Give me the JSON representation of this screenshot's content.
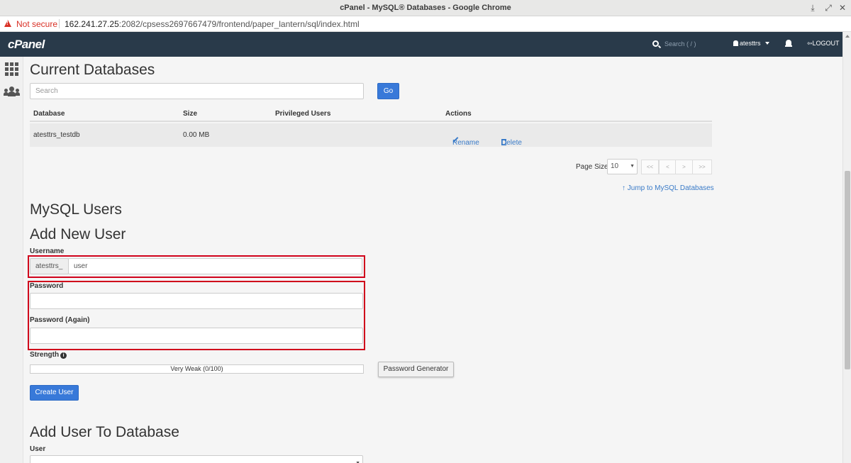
{
  "window": {
    "title": "cPanel - MySQL® Databases - Google Chrome"
  },
  "address_bar": {
    "security_label": "Not secure",
    "url_host": "162.241.27.25",
    "url_path": ":2082/cpsess2697667479/frontend/paper_lantern/sql/index.html"
  },
  "header": {
    "logo": "cPanel",
    "search_placeholder": "Search ( / )",
    "username": "atesttrs",
    "logout_label": "LOGOUT"
  },
  "current_databases": {
    "heading": "Current Databases",
    "search_placeholder": "Search",
    "go_label": "Go",
    "columns": [
      "Database",
      "Size",
      "Privileged Users",
      "Actions"
    ],
    "rows": [
      {
        "database": "atesttrs_testdb",
        "size": "0.00 MB",
        "privileged_users": "",
        "rename_label": "Rename",
        "delete_label": "Delete"
      }
    ],
    "page_size_label": "Page Size",
    "page_size_value": "10",
    "pager": [
      "<<",
      "<",
      ">",
      ">>"
    ],
    "jump_link": "Jump to MySQL Databases"
  },
  "mysql_users": {
    "heading": "MySQL Users",
    "add_new_user_heading": "Add New User",
    "username_label": "Username",
    "username_prefix": "atesttrs_",
    "username_value": "user",
    "password_label": "Password",
    "password_again_label": "Password (Again)",
    "strength_label": "Strength",
    "strength_text": "Very Weak (0/100)",
    "strength_value": 0,
    "password_generator_label": "Password Generator",
    "create_user_label": "Create User"
  },
  "add_user_to_database": {
    "heading": "Add User To Database",
    "user_label": "User"
  },
  "colors": {
    "header_bg": "#293a4a",
    "primary": "#3879d9",
    "highlight_box": "#d0021b",
    "link": "#3a7bc8"
  }
}
